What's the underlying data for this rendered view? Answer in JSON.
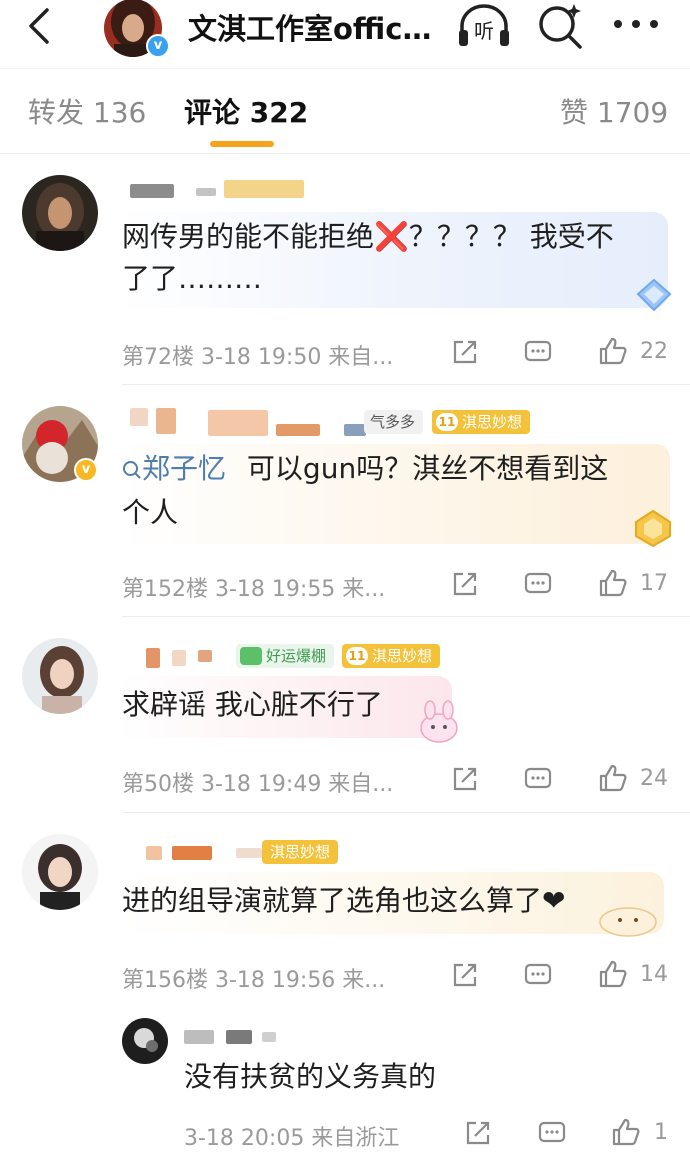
{
  "header": {
    "title": "文淇工作室offic…",
    "listen_label": "听",
    "verified_badge": "v"
  },
  "tabs": {
    "repost": "转发 136",
    "comments": "评论 322",
    "likes": "赞 1709"
  },
  "comments": [
    {
      "text": "网传男的能不能拒绝❌？？？？ 我受不了了………",
      "line1": "网传男的能不能拒绝❌？？？？ 我受不",
      "line2": "了了………",
      "meta": "第72楼  3-18 19:50  来自...",
      "likes": "22"
    },
    {
      "mention": "郑子忆",
      "text": "可以gun吗？淇丝不想看到这个人",
      "line1": "可以gun吗？淇丝不想看到这",
      "line2": "个人",
      "tags": [
        "气多多",
        "淇思妙想"
      ],
      "tag_level": "11",
      "meta": "第152楼  3-18 19:55  来...",
      "likes": "17"
    },
    {
      "text": "求辟谣 我心脏不行了",
      "tags": [
        "好运爆棚",
        "淇思妙想"
      ],
      "tag_level": "11",
      "meta": "第50楼  3-18 19:49  来自...",
      "likes": "24"
    },
    {
      "text": "进的组导演就算了选角也这么算了❤",
      "tags": [
        "淇思妙想"
      ],
      "meta": "第156楼  3-18 19:56  来...",
      "likes": "14"
    }
  ],
  "reply": {
    "text": "没有扶贫的义务真的",
    "meta": "3-18 20:05  来自浙江",
    "likes": "1"
  },
  "colors": {
    "accent": "#f7a21b",
    "mention": "#507daf",
    "meta": "#9a9a9a",
    "tag_gold": "#f3c23a",
    "tag_green": "#5cc06b"
  },
  "icons": [
    "back-icon",
    "listen-icon",
    "search-icon",
    "more-icon",
    "share-icon",
    "comment-icon",
    "like-icon"
  ]
}
